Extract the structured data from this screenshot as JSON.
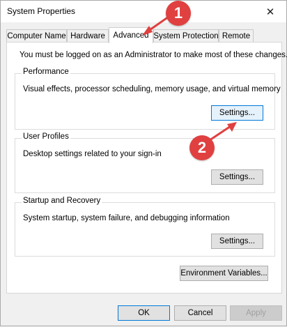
{
  "window": {
    "title": "System Properties",
    "close_glyph": "✕"
  },
  "tabs": [
    {
      "label": "Computer Name"
    },
    {
      "label": "Hardware"
    },
    {
      "label": "Advanced",
      "active": true
    },
    {
      "label": "System Protection"
    },
    {
      "label": "Remote"
    }
  ],
  "intro_text": "You must be logged on as an Administrator to make most of these changes.",
  "groups": {
    "performance": {
      "label": "Performance",
      "description": "Visual effects, processor scheduling, memory usage, and virtual memory",
      "button": "Settings..."
    },
    "user_profiles": {
      "label": "User Profiles",
      "description": "Desktop settings related to your sign-in",
      "button": "Settings..."
    },
    "startup_recovery": {
      "label": "Startup and Recovery",
      "description": "System startup, system failure, and debugging information",
      "button": "Settings..."
    }
  },
  "env_button": "Environment Variables...",
  "footer": {
    "ok": "OK",
    "cancel": "Cancel",
    "apply": "Apply"
  },
  "annotations": {
    "step1": "1",
    "step2": "2",
    "color": "#e04040"
  }
}
